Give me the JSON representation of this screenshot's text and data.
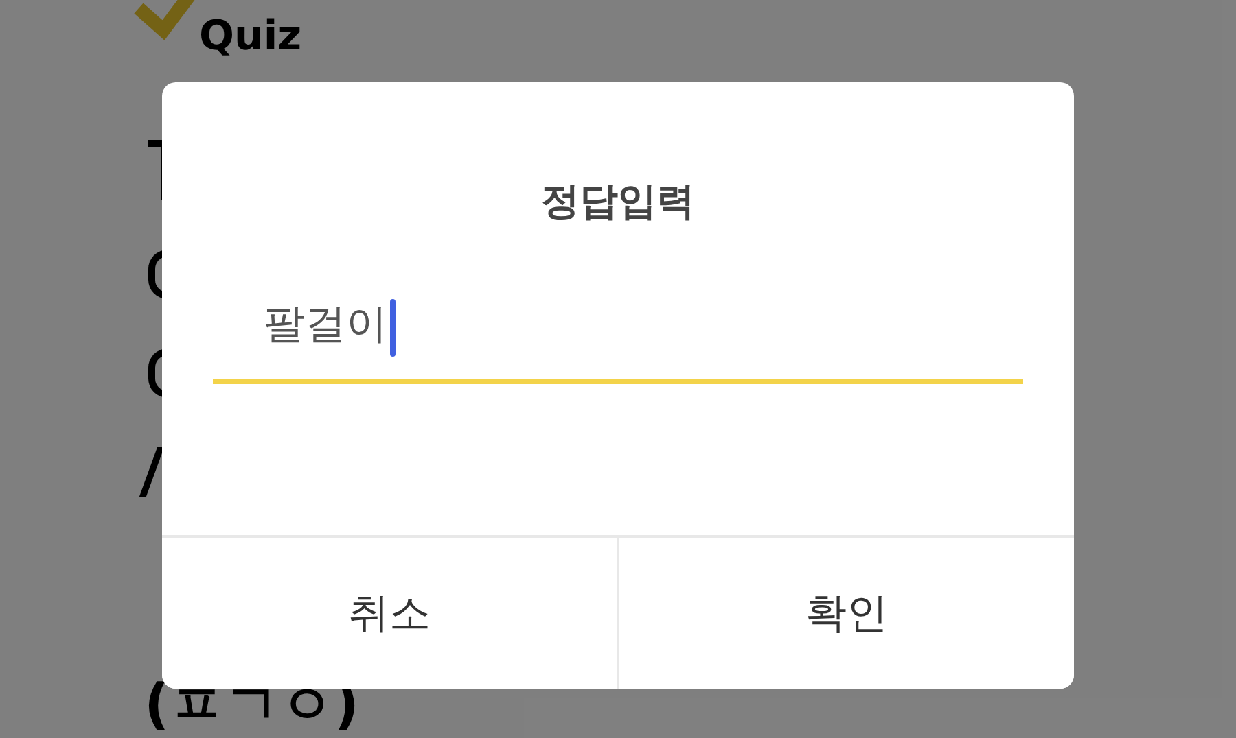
{
  "background": {
    "logo": "Quiz",
    "hint": "(ㅍㄱㅇ)"
  },
  "dialog": {
    "title": "정답입력",
    "input": {
      "value": "팔걸이",
      "focused": true
    },
    "buttons": [
      {
        "label": "취소"
      },
      {
        "label": "확인"
      }
    ]
  }
}
